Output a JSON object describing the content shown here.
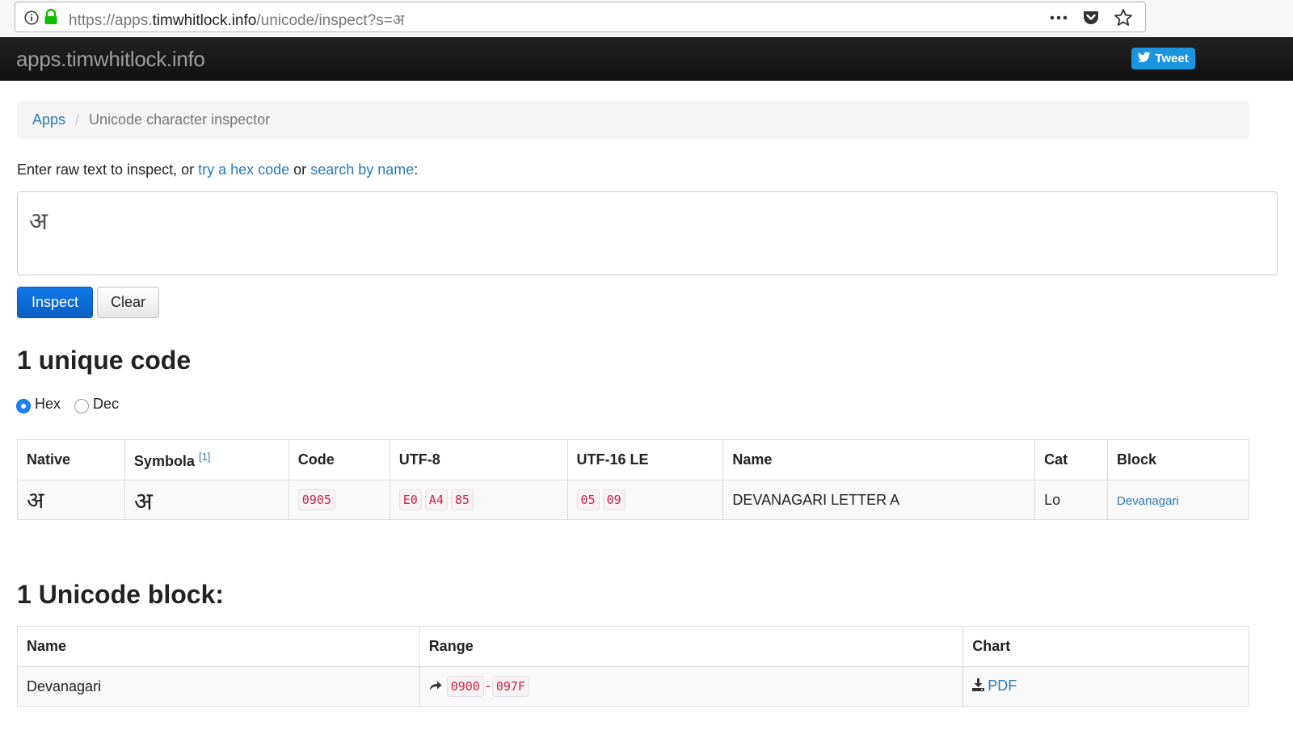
{
  "browser": {
    "url_prefix": "https://apps.",
    "url_domain": "timwhitlock.info",
    "url_rest": "/unicode/inspect?s=अ",
    "icons": [
      "info-icon",
      "lock-icon",
      "more-icon",
      "pocket-icon",
      "bookmark-star-icon"
    ]
  },
  "header": {
    "site_title": "apps.timwhitlock.info",
    "tweet_label": "Tweet"
  },
  "breadcrumb": {
    "root": "Apps",
    "current": "Unicode character inspector"
  },
  "intro": {
    "text_before": "Enter raw text to inspect, or ",
    "link_hex": "try a hex code",
    "text_mid": " or ",
    "link_name": "search by name",
    "text_after": ":"
  },
  "input": {
    "value": "अ"
  },
  "buttons": {
    "inspect": "Inspect",
    "clear": "Clear"
  },
  "codes_heading": "1 unique code",
  "radios": {
    "hex": "Hex",
    "dec": "Dec",
    "selected": "Hex"
  },
  "codes_table": {
    "headers": {
      "native": "Native",
      "symbola": "Symbola",
      "symbola_footnote": "[1]",
      "code": "Code",
      "utf8": "UTF-8",
      "utf16": "UTF-16 LE",
      "name": "Name",
      "cat": "Cat",
      "block": "Block"
    },
    "rows": [
      {
        "native": "अ",
        "symbola": "अ",
        "code": "0905",
        "utf8": [
          "E0",
          "A4",
          "85"
        ],
        "utf16": [
          "05",
          "09"
        ],
        "name": "DEVANAGARI LETTER A",
        "cat": "Lo",
        "block": "Devanagari"
      }
    ]
  },
  "blocks_heading": "1 Unicode block:",
  "blocks_table": {
    "headers": {
      "name": "Name",
      "range": "Range",
      "chart": "Chart"
    },
    "rows": [
      {
        "name": "Devanagari",
        "range_start": "0900",
        "range_sep": "-",
        "range_end": "097F",
        "chart": "PDF"
      }
    ]
  },
  "colors": {
    "link": "#2a7ab8",
    "primary_button": "#0a5fc4",
    "code_text": "#c7254e",
    "header_bg": "#1a1a1a",
    "tweet_bg": "#1b95e0"
  }
}
